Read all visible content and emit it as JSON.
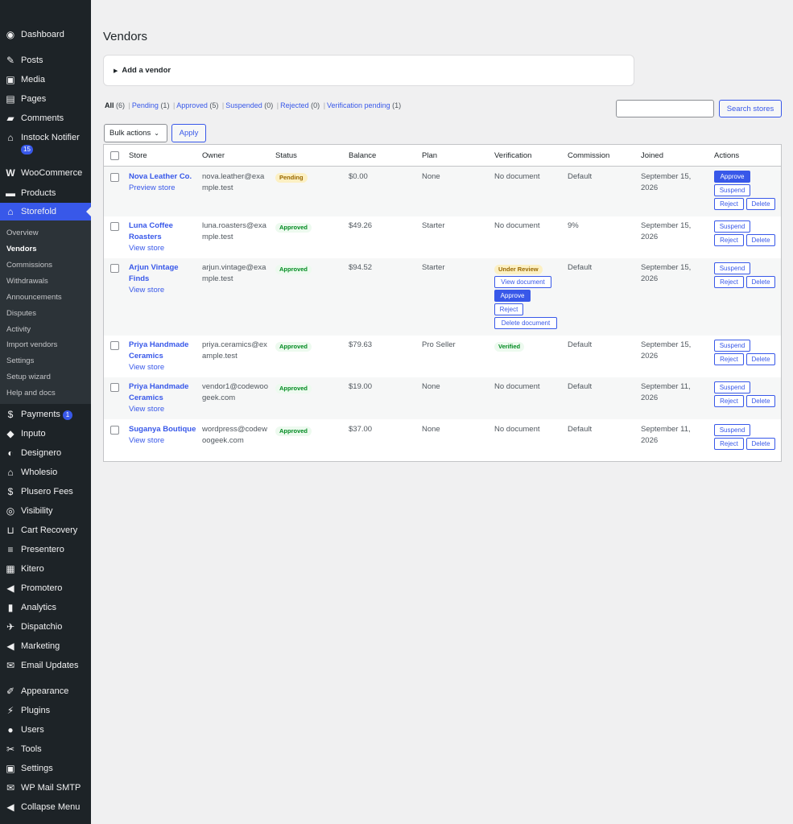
{
  "sidebar": {
    "menu": [
      {
        "label": "Dashboard",
        "icon": "dashboard-icon"
      },
      {
        "label": "Posts",
        "icon": "pin-icon"
      },
      {
        "label": "Media",
        "icon": "media-icon"
      },
      {
        "label": "Pages",
        "icon": "pages-icon"
      },
      {
        "label": "Comments",
        "icon": "comment-icon"
      },
      {
        "label": "Instock Notifier",
        "icon": "notifier-icon",
        "badge": "15"
      },
      {
        "label": "WooCommerce",
        "icon": "woocommerce-icon"
      },
      {
        "label": "Products",
        "icon": "products-icon"
      },
      {
        "label": "Storefold",
        "icon": "storefront-icon"
      },
      {
        "label": "Payments",
        "icon": "payments-icon",
        "badge": "1"
      },
      {
        "label": "Inputo",
        "icon": "tag-icon"
      },
      {
        "label": "Designero",
        "icon": "palette-icon"
      },
      {
        "label": "Wholesio",
        "icon": "store-icon"
      },
      {
        "label": "Plusero Fees",
        "icon": "dollar-icon"
      },
      {
        "label": "Visibility",
        "icon": "eye-icon"
      },
      {
        "label": "Cart Recovery",
        "icon": "cart-icon"
      },
      {
        "label": "Presentero",
        "icon": "stack-icon"
      },
      {
        "label": "Kitero",
        "icon": "grid-icon"
      },
      {
        "label": "Promotero",
        "icon": "megaphone-icon"
      },
      {
        "label": "Analytics",
        "icon": "chart-icon"
      },
      {
        "label": "Dispatchio",
        "icon": "plane-icon"
      },
      {
        "label": "Marketing",
        "icon": "marketing-icon"
      },
      {
        "label": "Email Updates",
        "icon": "email-icon"
      },
      {
        "label": "Appearance",
        "icon": "brush-icon"
      },
      {
        "label": "Plugins",
        "icon": "plugin-icon"
      },
      {
        "label": "Users",
        "icon": "user-icon"
      },
      {
        "label": "Tools",
        "icon": "wrench-icon"
      },
      {
        "label": "Settings",
        "icon": "settings-icon"
      },
      {
        "label": "WP Mail SMTP",
        "icon": "mail-icon"
      },
      {
        "label": "Collapse Menu",
        "icon": "collapse-icon"
      }
    ],
    "submenu": [
      "Overview",
      "Vendors",
      "Commissions",
      "Withdrawals",
      "Announcements",
      "Disputes",
      "Activity",
      "Import vendors",
      "Settings",
      "Setup wizard",
      "Help and docs"
    ],
    "colors": {
      "background": "#1d2327",
      "accent": "#3858e9"
    }
  },
  "page": {
    "title": "Vendors",
    "add_vendor": "Add a vendor"
  },
  "filters": [
    {
      "label": "All",
      "count": "(6)"
    },
    {
      "label": "Pending",
      "count": "(1)"
    },
    {
      "label": "Approved",
      "count": "(5)"
    },
    {
      "label": "Suspended",
      "count": "(0)"
    },
    {
      "label": "Rejected",
      "count": "(0)"
    },
    {
      "label": "Verification pending",
      "count": "(1)"
    }
  ],
  "search": {
    "value": "",
    "button": "Search stores"
  },
  "bulk": {
    "selected": "Bulk actions",
    "apply": "Apply"
  },
  "table": {
    "columns": [
      "Store",
      "Owner",
      "Status",
      "Balance",
      "Plan",
      "Verification",
      "Commission",
      "Joined",
      "Actions"
    ],
    "rows": [
      {
        "store": "Nova Leather Co.",
        "store_link": "Preview store",
        "owner": "nova.leather@example.test",
        "status": "Pending",
        "balance": "$0.00",
        "plan": "None",
        "verification": "No document",
        "commission": "Default",
        "joined": "September 15, 2026",
        "actions": [
          "Approve",
          "Suspend",
          "Reject",
          "Delete"
        ]
      },
      {
        "store": "Luna Coffee Roasters",
        "store_link": "View store",
        "owner": "luna.roasters@example.test",
        "status": "Approved",
        "balance": "$49.26",
        "plan": "Starter",
        "verification": "No document",
        "commission": "9%",
        "joined": "September 15, 2026",
        "actions": [
          "Suspend",
          "Reject",
          "Delete"
        ]
      },
      {
        "store": "Arjun Vintage Finds",
        "store_link": "View store",
        "owner": "arjun.vintage@example.test",
        "status": "Approved",
        "balance": "$94.52",
        "plan": "Starter",
        "verification": "Under Review",
        "verification_actions": [
          "View document",
          "Approve",
          "Reject",
          "Delete document"
        ],
        "commission": "Default",
        "joined": "September 15, 2026",
        "actions": [
          "Suspend",
          "Reject",
          "Delete"
        ]
      },
      {
        "store": "Priya Handmade Ceramics",
        "store_link": "View store",
        "owner": "priya.ceramics@example.test",
        "status": "Approved",
        "balance": "$79.63",
        "plan": "Pro Seller",
        "verification": "Verified",
        "commission": "Default",
        "joined": "September 15, 2026",
        "actions": [
          "Suspend",
          "Reject",
          "Delete"
        ]
      },
      {
        "store": "Priya Handmade Ceramics",
        "store_link": "View store",
        "owner": "vendor1@codewoogeek.com",
        "status": "Approved",
        "balance": "$19.00",
        "plan": "None",
        "verification": "No document",
        "commission": "Default",
        "joined": "September 11, 2026",
        "actions": [
          "Suspend",
          "Reject",
          "Delete"
        ]
      },
      {
        "store": "Suganya Boutique",
        "store_link": "View store",
        "owner": "wordpress@codewoogeek.com",
        "status": "Approved",
        "balance": "$37.00",
        "plan": "None",
        "verification": "No document",
        "commission": "Default",
        "joined": "September 11, 2026",
        "actions": [
          "Suspend",
          "Reject",
          "Delete"
        ]
      }
    ]
  }
}
